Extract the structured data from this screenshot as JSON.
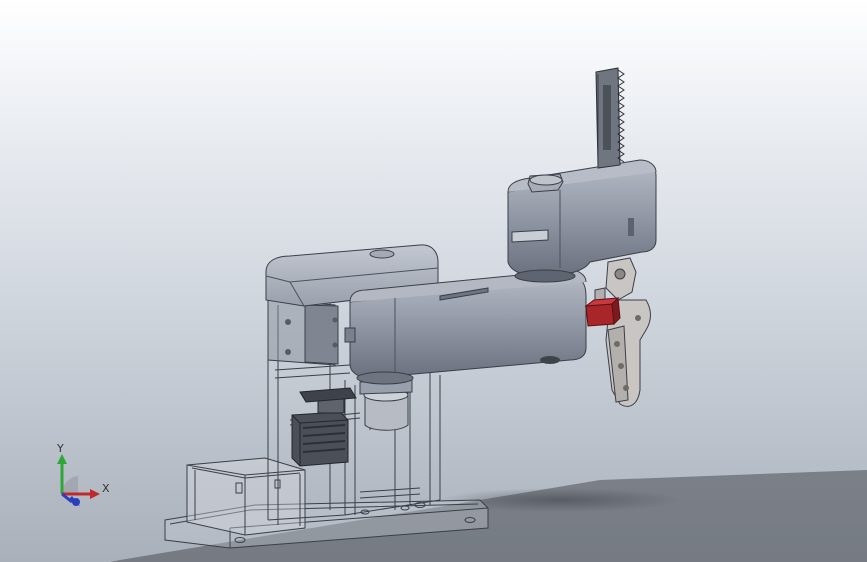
{
  "viewport": {
    "colors": {
      "background_top": "#ffffff",
      "background_bottom": "#a9b0ba",
      "part_fill": "#8f96a3",
      "part_dark": "#5c6270",
      "part_light": "#b9bec8",
      "wireframe": "#3a3f48",
      "gripper_fill": "#c9c5c2",
      "red_block": "#a8252a"
    }
  },
  "triad": {
    "y_label": "Y",
    "x_label": "X",
    "colors": {
      "y": "#2fa63a",
      "x": "#c0282d",
      "z": "#2a3fbf"
    }
  }
}
